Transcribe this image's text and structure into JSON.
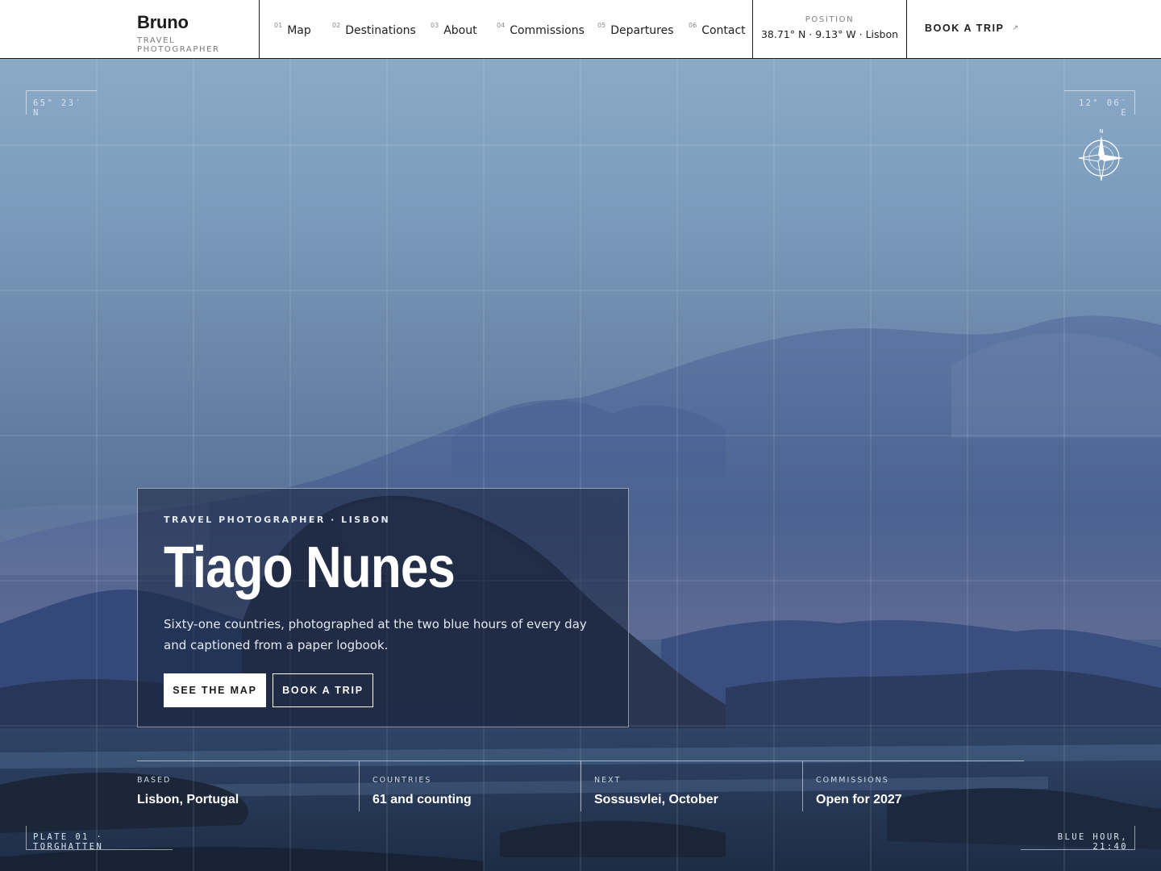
{
  "brand": {
    "name": "Bruno",
    "tagline": "TRAVEL PHOTOGRAPHER"
  },
  "nav": {
    "items": [
      {
        "num": "01",
        "label": "Map"
      },
      {
        "num": "02",
        "label": "Destinations"
      },
      {
        "num": "03",
        "label": "About"
      },
      {
        "num": "04",
        "label": "Commissions"
      },
      {
        "num": "05",
        "label": "Departures"
      },
      {
        "num": "06",
        "label": "Contact"
      }
    ]
  },
  "position": {
    "label": "POSITION",
    "value": "38.71° N · 9.13° W · Lisbon"
  },
  "header_cta": {
    "label": "BOOK A TRIP",
    "icon": "arrow-up-right-icon"
  },
  "hero": {
    "corners": {
      "top_left": "65° 23′ N",
      "top_right": "12° 06′ E",
      "bottom_left": "PLATE 01 · TORGHATTEN",
      "bottom_right": "BLUE HOUR, 21:40"
    },
    "compass": {
      "north_label": "N",
      "icon": "compass-rose-icon"
    },
    "eyebrow": "TRAVEL PHOTOGRAPHER · LISBON",
    "title": "Tiago Nunes",
    "lede": "Sixty-one countries, photographed at the two blue hours of every day and captioned from a paper logbook.",
    "primary_button": "SEE THE MAP",
    "secondary_button": "BOOK A TRIP"
  },
  "facts": [
    {
      "label": "BASED",
      "value": "Lisbon, Portugal"
    },
    {
      "label": "COUNTRIES",
      "value": "61 and counting"
    },
    {
      "label": "NEXT",
      "value": "Sossusvlei, October"
    },
    {
      "label": "COMMISSIONS",
      "value": "Open for 2027"
    }
  ],
  "colors": {
    "ink": "#1c1c1c",
    "hero_sky": "#7c9cbd",
    "hero_deep": "#2c3d5c",
    "card": "#18223a"
  }
}
